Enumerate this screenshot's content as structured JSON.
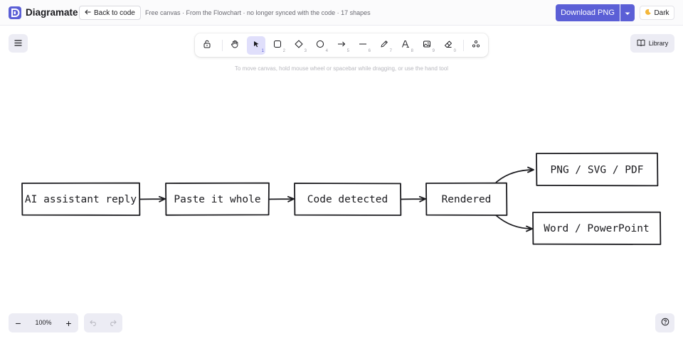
{
  "app": {
    "name": "Diagramate"
  },
  "header": {
    "back_label": "Back to code",
    "info": "Free canvas · From the Flowchart · no longer synced with the code · 17 shapes",
    "download_label": "Download PNG",
    "theme_label": "Dark"
  },
  "toolbar": {
    "tools": [
      {
        "name": "lock",
        "shortcut": ""
      },
      {
        "name": "hand",
        "shortcut": ""
      },
      {
        "name": "selection",
        "shortcut": "1"
      },
      {
        "name": "rectangle",
        "shortcut": "2"
      },
      {
        "name": "diamond",
        "shortcut": "3"
      },
      {
        "name": "ellipse",
        "shortcut": "4"
      },
      {
        "name": "arrow",
        "shortcut": "5"
      },
      {
        "name": "line",
        "shortcut": "6"
      },
      {
        "name": "draw",
        "shortcut": "7"
      },
      {
        "name": "text",
        "shortcut": "8"
      },
      {
        "name": "image",
        "shortcut": "9"
      },
      {
        "name": "eraser",
        "shortcut": "0"
      },
      {
        "name": "extra-tools",
        "shortcut": ""
      }
    ],
    "active_tool": "selection"
  },
  "hint": "To move canvas, hold mouse wheel or spacebar while dragging, or use the hand tool",
  "library_label": "Library",
  "zoom": {
    "level": "100%",
    "minus": "−",
    "plus": "+"
  },
  "diagram": {
    "nodes": [
      {
        "id": "ai-reply",
        "label": "AI assistant reply"
      },
      {
        "id": "paste",
        "label": "Paste it whole"
      },
      {
        "id": "detected",
        "label": "Code detected"
      },
      {
        "id": "rendered",
        "label": "Rendered"
      },
      {
        "id": "png",
        "label": "PNG / SVG / PDF"
      },
      {
        "id": "word",
        "label": "Word / PowerPoint"
      }
    ]
  },
  "colors": {
    "accent": "#5b5fd6",
    "active_tool_bg": "#e0dffb",
    "stroke": "#1b1b1f",
    "panel": "#ececf4"
  }
}
